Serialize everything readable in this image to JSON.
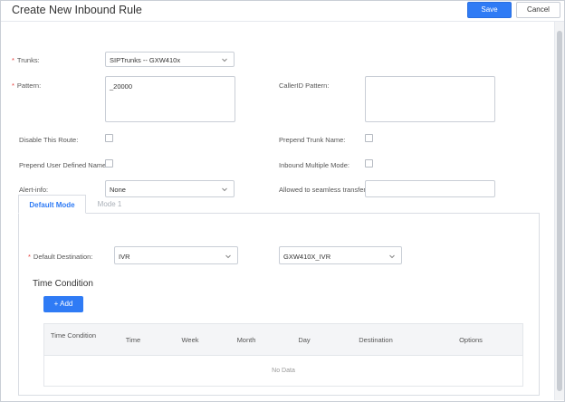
{
  "header": {
    "title": "Create New Inbound Rule",
    "save_label": "Save",
    "cancel_label": "Cancel"
  },
  "form": {
    "trunks": {
      "label": "Trunks:",
      "value": "SIPTrunks -- GXW410x"
    },
    "pattern": {
      "label": "Pattern:",
      "value": "_20000"
    },
    "callerid_pattern": {
      "label": "CallerID Pattern:",
      "value": ""
    },
    "disable_route": {
      "label": "Disable This Route:",
      "checked": false
    },
    "prepend_trunk_name": {
      "label": "Prepend Trunk Name:",
      "checked": false
    },
    "prepend_user_defined_name": {
      "label": "Prepend User Defined Name:",
      "checked": false
    },
    "inbound_multiple_mode": {
      "label": "Inbound Multiple Mode:",
      "checked": false
    },
    "alert_info": {
      "label": "Alert-info:",
      "value": "None"
    },
    "seamless_transfer": {
      "label": "Allowed to seamless transfer:",
      "value": ""
    }
  },
  "tabs": [
    {
      "label": "Default Mode",
      "active": true
    },
    {
      "label": "Mode 1",
      "active": false
    }
  ],
  "default_mode": {
    "destination_label": "Default Destination:",
    "destination_type": "IVR",
    "destination_value": "GXW410X_IVR"
  },
  "time_condition": {
    "title": "Time Condition",
    "add_label": "+ Add",
    "columns": [
      "Time Condition",
      "Time",
      "Week",
      "Month",
      "Day",
      "Destination",
      "Options"
    ],
    "empty_text": "No Data"
  },
  "colors": {
    "primary": "#2f7bf5",
    "required": "#e53935"
  }
}
